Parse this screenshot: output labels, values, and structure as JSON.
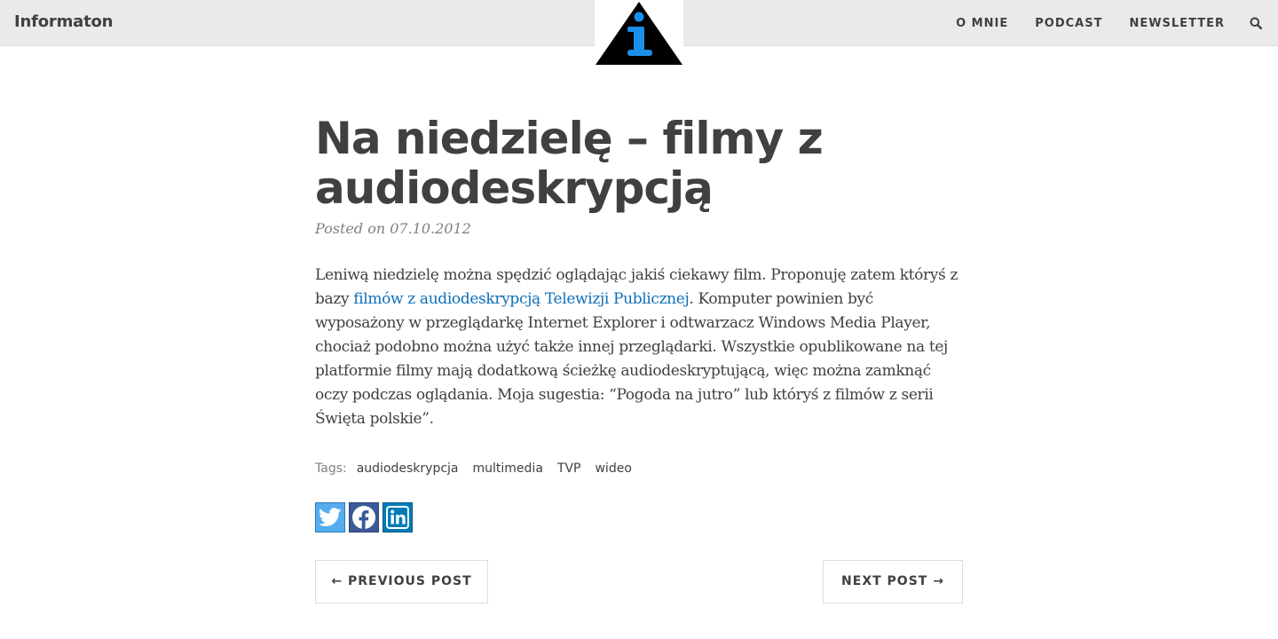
{
  "header": {
    "brand": "Informaton",
    "logo_icon": "info-triangle-logo",
    "nav": [
      {
        "label": "O MNIE"
      },
      {
        "label": "PODCAST"
      },
      {
        "label": "NEWSLETTER"
      }
    ],
    "search_icon": "search-icon"
  },
  "post": {
    "title": "Na niedzielę – filmy z audiodeskrypcją",
    "meta": "Posted on 07.10.2012",
    "body_before_link": "Leniwą niedzielę można spędzić oglądając jakiś ciekawy film. Proponuję zatem któryś z bazy ",
    "link_text": "filmów z audiodeskrypcją Telewizji Publicznej",
    "body_after_link": ". Komputer powinien być wyposażony w przeglądarkę Internet Explorer i odtwarzacz Windows Media Player, chociaż podobno można użyć także innej przeglądarki. Wszystkie opublikowane na tej platformie filmy mają dodatkową ścieżkę audiodeskryptującą, więc można zamknąć oczy podczas oglądania. Moja sugestia: “Pogoda na jutro” lub któryś z filmów z serii Święta polskie”."
  },
  "tags": {
    "label": "Tags:",
    "items": [
      "audiodeskrypcja",
      "multimedia",
      "TVP",
      "wideo"
    ]
  },
  "share": {
    "icons": [
      "twitter-icon",
      "facebook-icon",
      "linkedin-icon"
    ],
    "colors": {
      "twitter": "#55acee",
      "facebook": "#3b5998",
      "linkedin": "#007bb5"
    }
  },
  "pager": {
    "prev": "← PREVIOUS POST",
    "next": "NEXT POST →"
  },
  "colors": {
    "header_bg": "#eaeaea",
    "text": "#404040",
    "link": "#0d6fb8",
    "logo_triangle": "#000000",
    "logo_i": "#1a8ee8"
  }
}
